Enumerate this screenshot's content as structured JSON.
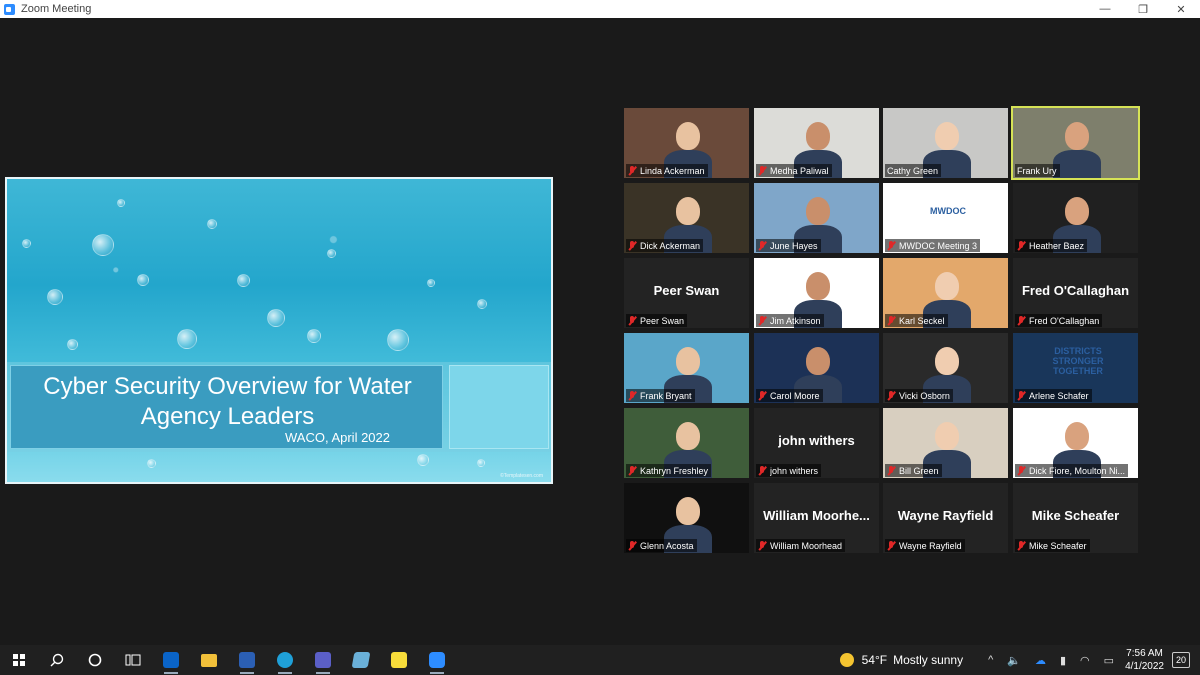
{
  "window": {
    "title": "Zoom Meeting",
    "controls": [
      "—",
      "❐",
      "✕"
    ]
  },
  "slide": {
    "title": "Cyber Security Overview for Water Agency Leaders",
    "subtitle": "WACO, April 2022",
    "watermark": "©Templatesen.com"
  },
  "participants": [
    {
      "name": "Linda Ackerman",
      "muted": true,
      "has_video": true
    },
    {
      "name": "Medha Paliwal",
      "muted": true,
      "has_video": true
    },
    {
      "name": "Cathy Green",
      "muted": false,
      "has_video": true
    },
    {
      "name": "Frank Ury",
      "muted": false,
      "has_video": true,
      "active_speaker": true
    },
    {
      "name": "Dick Ackerman",
      "muted": true,
      "has_video": true
    },
    {
      "name": "June Hayes",
      "muted": true,
      "has_video": true
    },
    {
      "name": "MWDOC Meeting 3",
      "muted": true,
      "has_video": true,
      "logo_text": "MWDOC"
    },
    {
      "name": "Heather Baez",
      "muted": true,
      "has_video": true
    },
    {
      "name": "Peer Swan",
      "muted": true,
      "has_video": false,
      "display": "Peer Swan"
    },
    {
      "name": "Jim Atkinson",
      "muted": true,
      "has_video": true
    },
    {
      "name": "Karl Seckel",
      "muted": true,
      "has_video": true
    },
    {
      "name": "Fred O'Callaghan",
      "muted": true,
      "has_video": false,
      "display": "Fred O'Callaghan"
    },
    {
      "name": "Frank Bryant",
      "muted": true,
      "has_video": true
    },
    {
      "name": "Carol Moore",
      "muted": true,
      "has_video": true
    },
    {
      "name": "Vicki Osborn",
      "muted": true,
      "has_video": true
    },
    {
      "name": "Arlene Schafer",
      "muted": true,
      "has_video": true,
      "logo_text": "DISTRICTS STRONGER TOGETHER"
    },
    {
      "name": "Kathryn Freshley",
      "muted": true,
      "has_video": true
    },
    {
      "name": "john withers",
      "muted": true,
      "has_video": false,
      "display": "john withers"
    },
    {
      "name": "Bill Green",
      "muted": true,
      "has_video": true
    },
    {
      "name": "Dick Fiore, Moulton Ni...",
      "muted": true,
      "has_video": true
    },
    {
      "name": "Glenn Acosta",
      "muted": true,
      "has_video": true
    },
    {
      "name": "William Moorhead",
      "muted": true,
      "has_video": false,
      "display": "William  Moorhe..."
    },
    {
      "name": "Wayne Rayfield",
      "muted": true,
      "has_video": false,
      "display": "Wayne Rayfield"
    },
    {
      "name": "Mike Scheafer",
      "muted": true,
      "has_video": false,
      "display": "Mike Scheafer"
    }
  ],
  "taskbar": {
    "apps": [
      "search-icon",
      "cortana-icon",
      "task-view-icon",
      "outlook-icon",
      "file-explorer-icon",
      "word-icon",
      "edge-icon",
      "teams-icon",
      "notepad-icon",
      "sticky-notes-icon",
      "zoom-icon"
    ],
    "weather": {
      "temp": "54°F",
      "condition": "Mostly sunny"
    },
    "time": "7:56 AM",
    "date": "4/1/2022",
    "notifications": "20",
    "colors": {
      "outlook": "#0a64c8",
      "explorer": "#f2c03a",
      "word": "#2b5fb4",
      "edge": "#1fa0d8",
      "teams": "#5b5fc7",
      "notepad": "#6ab0d8",
      "sticky": "#f7dc3a",
      "zoom": "#2d8cff"
    }
  }
}
